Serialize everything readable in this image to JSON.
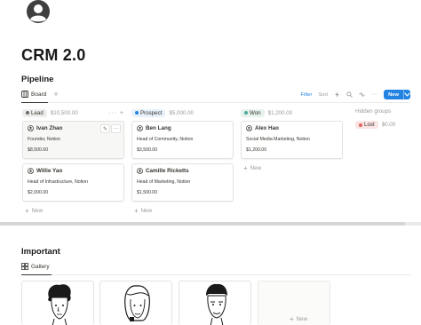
{
  "page": {
    "title": "CRM 2.0"
  },
  "pipeline": {
    "section_title": "Pipeline",
    "view_tab": "Board",
    "toolbar": {
      "filter": "Filter",
      "sort": "Sort",
      "new": "New"
    },
    "columns": [
      {
        "name": "Lead",
        "sum": "$10,500.00",
        "dot_color": "#6b6b6b",
        "pill_bg": "#ededeb",
        "cards": [
          {
            "name": "Ivan Zhao",
            "role": "Founder, Notion",
            "value": "$8,500.00"
          },
          {
            "name": "Willie Yao",
            "role": "Head of Infrastructure, Notion",
            "value": "$2,000.00"
          }
        ]
      },
      {
        "name": "Prospect",
        "sum": "$5,000.00",
        "dot_color": "#2383e2",
        "pill_bg": "#e7f0fb",
        "cards": [
          {
            "name": "Ben Lang",
            "role": "Head of Community, Notion",
            "value": "$3,500.00"
          },
          {
            "name": "Camille Ricketts",
            "role": "Head of Marketing, Notion",
            "value": "$1,500.00"
          }
        ]
      },
      {
        "name": "Won",
        "sum": "$1,200.00",
        "dot_color": "#4dab9a",
        "pill_bg": "#e6f2ec",
        "cards": [
          {
            "name": "Alex Hao",
            "role": "Social Media Marketing, Notion",
            "value": "$1,200.00"
          }
        ]
      }
    ],
    "new_row_label": "New",
    "hidden_groups": {
      "label": "Hidden groups",
      "group_name": "Lost",
      "group_sum": "$0.00",
      "dot_color": "#e16259",
      "pill_bg": "#fbe4e4"
    }
  },
  "important": {
    "section_title": "Important",
    "view_tab": "Gallery",
    "new_label": "New"
  },
  "icons": {
    "page_icon": "user-circle-icon",
    "board_tab": "board-icon",
    "gallery_tab": "gallery-icon",
    "person": "person-icon",
    "edit": "pencil-icon",
    "more": "ellipsis-icon",
    "lightning": "automation-icon",
    "search": "search-icon",
    "link": "link-icon",
    "more_toolbar": "ellipsis-icon"
  },
  "colors": {
    "accent": "#2383e2",
    "text": "#37352f",
    "muted": "#9b9a97"
  }
}
